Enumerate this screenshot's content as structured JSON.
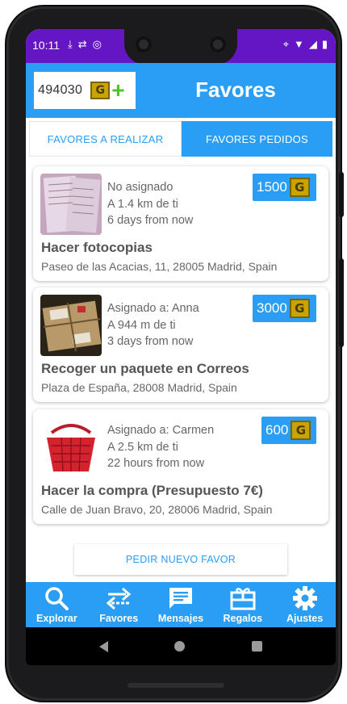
{
  "status_bar": {
    "time": "10:11"
  },
  "header": {
    "coins": "494030",
    "coin_glyph": "G",
    "add_symbol": "+",
    "title": "Favores"
  },
  "tabs": [
    {
      "label": "FAVORES A REALIZAR",
      "active": false
    },
    {
      "label": "FAVORES PEDIDOS",
      "active": true
    }
  ],
  "favors": [
    {
      "status": "No asignado",
      "distance": "A 1.4 km de ti",
      "time": "6 days from now",
      "price": "1500",
      "title": "Hacer fotocopias",
      "address": "Paseo de las Acacias, 11, 28005 Madrid, Spain"
    },
    {
      "status": "Asignado a: Anna",
      "distance": "A 944 m de ti",
      "time": "3 days from now",
      "price": "3000",
      "title": "Recoger un paquete en Correos",
      "address": "Plaza de España, 28008 Madrid, Spain"
    },
    {
      "status": "Asignado a: Carmen",
      "distance": "A 2.5 km de ti",
      "time": "22 hours from now",
      "price": "600",
      "title": "Hacer la compra (Presupuesto 7€)",
      "address": "Calle de Juan Bravo, 20, 28006 Madrid, Spain"
    }
  ],
  "new_favor_button": "PEDIR NUEVO FAVOR",
  "bottom_nav": [
    {
      "label": "Explorar",
      "icon": "search-icon"
    },
    {
      "label": "Favores",
      "icon": "swap-icon"
    },
    {
      "label": "Mensajes",
      "icon": "message-icon"
    },
    {
      "label": "Regalos",
      "icon": "gift-icon"
    },
    {
      "label": "Ajustes",
      "icon": "gear-icon"
    }
  ],
  "colors": {
    "primary": "#2a9df4",
    "status_bar": "#6516c4",
    "coin": "#c9a400",
    "add": "#53c02c"
  }
}
